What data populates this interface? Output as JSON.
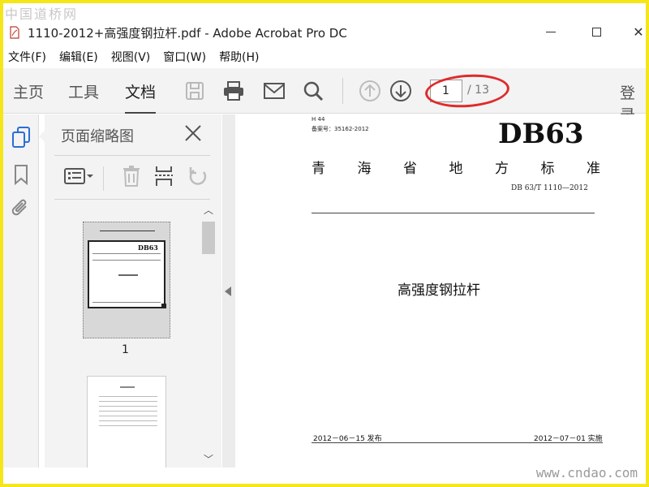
{
  "watermarks": {
    "top": "中国道桥网",
    "bottom": "www.cndao.com"
  },
  "window": {
    "title": "1110-2012+高强度钢拉杆.pdf - Adobe Acrobat Pro DC"
  },
  "menu": [
    "文件(F)",
    "编辑(E)",
    "视图(V)",
    "窗口(W)",
    "帮助(H)"
  ],
  "toolbar": {
    "tabs": [
      "主页",
      "工具",
      "文档"
    ],
    "active_tab": "文档",
    "current_page": "1",
    "page_total": "/ 13",
    "login": "登录"
  },
  "panel": {
    "title": "页面缩略图",
    "thumb_label": "1"
  },
  "document": {
    "classification": "H 44",
    "record_no": "备案号：35162-2012",
    "code": "DB63",
    "heading_chars": [
      "青",
      "海",
      "省",
      "地",
      "方",
      "标",
      "准"
    ],
    "standard_no": "DB 63/T 1110—2012",
    "title": "高强度钢拉杆",
    "publish_date": "2012－06－15 发布",
    "effective_date": "2012－07－01 实施"
  },
  "colors": {
    "toolbar_bg": "#f3f3f3",
    "highlight_ellipse": "#e02a2a",
    "frame": "#f5e61a",
    "icon_accent": "#2a6dd9"
  }
}
